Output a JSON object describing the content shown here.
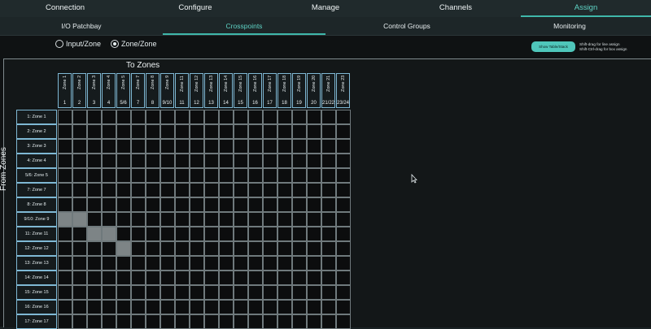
{
  "top_tabs": [
    {
      "label": "Connection",
      "active": false
    },
    {
      "label": "Configure",
      "active": false
    },
    {
      "label": "Manage",
      "active": false
    },
    {
      "label": "Channels",
      "active": false
    },
    {
      "label": "Assign",
      "active": true
    }
  ],
  "sub_tabs": [
    {
      "label": "I/O Patchbay",
      "active": false
    },
    {
      "label": "Crosspoints",
      "active": true
    },
    {
      "label": "Control Groups",
      "active": false
    },
    {
      "label": "Monitoring",
      "active": false
    }
  ],
  "modes": {
    "input_zone": "Input/Zone",
    "zone_zone": "Zone/Zone",
    "selected": "zone_zone"
  },
  "show_button_label": "Show Table/Stack",
  "hint": {
    "line1": "Shift-drag for line assign",
    "line2": "Shift-Ctrl-drag for box assign"
  },
  "to_title": "To Zones",
  "from_title": "From Zones",
  "columns": [
    {
      "name": "Zone 1",
      "num": "1"
    },
    {
      "name": "Zone 2",
      "num": "2"
    },
    {
      "name": "Zone 3",
      "num": "3"
    },
    {
      "name": "Zone 4",
      "num": "4"
    },
    {
      "name": "Zone 5",
      "num": "5/6"
    },
    {
      "name": "Zone 7",
      "num": "7"
    },
    {
      "name": "Zone 8",
      "num": "8"
    },
    {
      "name": "Zone 9",
      "num": "9/10"
    },
    {
      "name": "Zone 11",
      "num": "11"
    },
    {
      "name": "Zone 12",
      "num": "12"
    },
    {
      "name": "Zone 13",
      "num": "13"
    },
    {
      "name": "Zone 14",
      "num": "14"
    },
    {
      "name": "Zone 15",
      "num": "15"
    },
    {
      "name": "Zone 16",
      "num": "16"
    },
    {
      "name": "Zone 17",
      "num": "17"
    },
    {
      "name": "Zone 18",
      "num": "18"
    },
    {
      "name": "Zone 19",
      "num": "19"
    },
    {
      "name": "Zone 20",
      "num": "20"
    },
    {
      "name": "Zone 21",
      "num": "21/22"
    },
    {
      "name": "Zone 23",
      "num": "23/24"
    }
  ],
  "rows": [
    "1: Zone 1",
    "2: Zone 2",
    "3: Zone 3",
    "4: Zone 4",
    "5/6: Zone 5",
    "7: Zone 7",
    "8: Zone 8",
    "9/10: Zone 9",
    "11: Zone 11",
    "12: Zone 12",
    "13: Zone 13",
    "14: Zone 14",
    "15: Zone 15",
    "16: Zone 16",
    "17: Zone 17"
  ],
  "assigned": [
    [
      7,
      0
    ],
    [
      7,
      1
    ],
    [
      8,
      2
    ],
    [
      8,
      3
    ],
    [
      9,
      4
    ]
  ],
  "colors": {
    "accent": "#3fb7aa",
    "assigned_cell": "#7d8486"
  }
}
